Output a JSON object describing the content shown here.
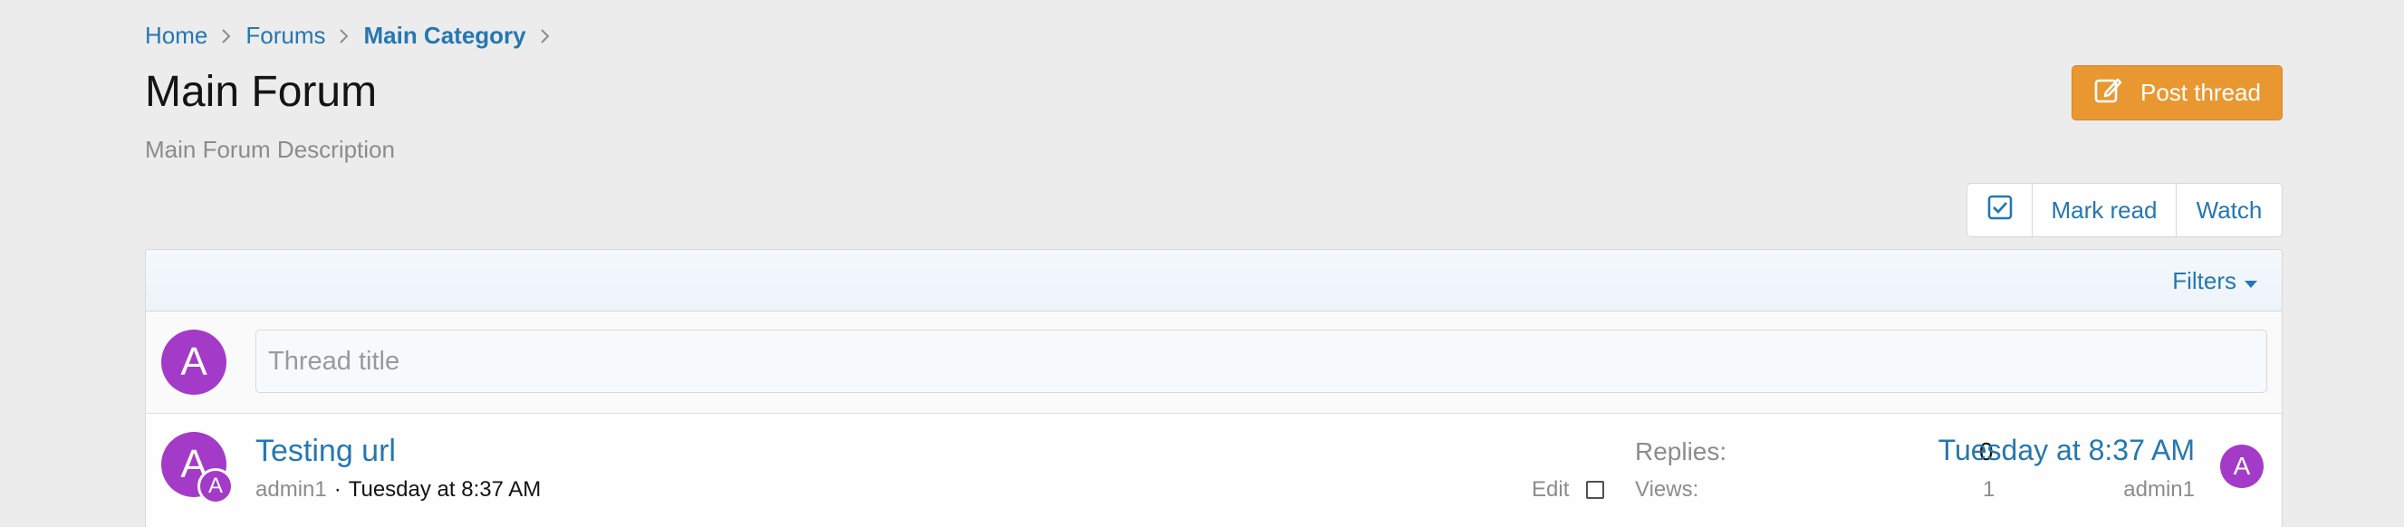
{
  "breadcrumb": [
    "Home",
    "Forums",
    "Main Category"
  ],
  "page": {
    "title": "Main Forum",
    "description": "Main Forum Description"
  },
  "actions": {
    "post_thread": "Post thread",
    "mark_read": "Mark read",
    "watch": "Watch"
  },
  "filters": {
    "label": "Filters"
  },
  "quick_thread": {
    "avatar_letter": "A",
    "placeholder": "Thread title"
  },
  "threads": [
    {
      "title": "Testing url",
      "author": "admin1",
      "date": "Tuesday at 8:37 AM",
      "avatar_letter": "A",
      "mini_avatar_letter": "A",
      "edit_label": "Edit",
      "replies_label": "Replies:",
      "replies": "0",
      "views_label": "Views:",
      "views": "1",
      "latest_date": "Tuesday at 8:37 AM",
      "latest_user": "admin1",
      "latest_avatar_letter": "A"
    }
  ],
  "colors": {
    "accent": "#2577b1",
    "button": "#e99831",
    "avatar": "#a33bc8"
  }
}
